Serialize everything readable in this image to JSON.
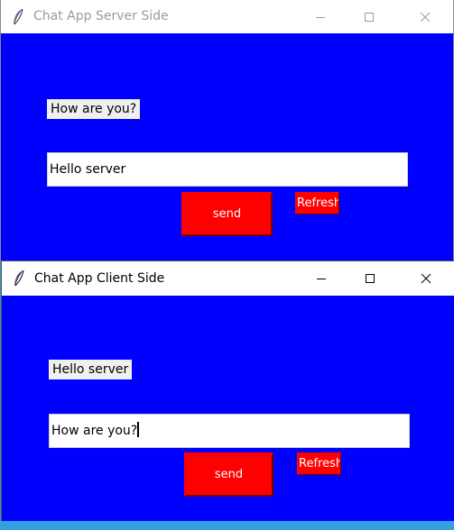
{
  "server_window": {
    "title": "Chat App Server Side",
    "received_label": "How are you?",
    "message_input_value": "Hello server",
    "send_label": "send",
    "refresh_label": "Refresh",
    "icons": {
      "app": "feather-icon",
      "minimize": "minimize-icon",
      "maximize": "maximize-icon",
      "close": "close-icon"
    }
  },
  "client_window": {
    "title": "Chat App Client Side",
    "received_label": "Hello server",
    "message_input_value": "How are you?",
    "send_label": "send",
    "refresh_label": "Refresh",
    "icons": {
      "app": "feather-icon",
      "minimize": "minimize-icon",
      "maximize": "maximize-icon",
      "close": "close-icon"
    }
  },
  "colors": {
    "window_background": "#0000ff",
    "button_background": "#ff0000",
    "button_text": "#ffffff",
    "label_background": "#f0f0f0",
    "desktop": "#2a8fd6"
  }
}
